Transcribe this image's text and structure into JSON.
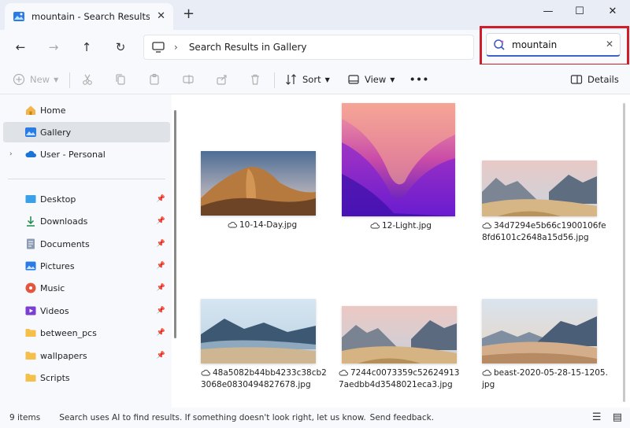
{
  "tab": {
    "title": "mountain - Search Results in Gallery",
    "close": "✕"
  },
  "new_tab": "+",
  "window_controls": {
    "minimize": "—",
    "maximize": "☐",
    "close": "✕"
  },
  "nav": {
    "back": "←",
    "forward": "→",
    "up": "↑",
    "refresh": "↻"
  },
  "address": {
    "separator": "›",
    "crumb": "Search Results in Gallery"
  },
  "search": {
    "value": "mountain",
    "clear": "✕"
  },
  "commands": {
    "new": "New",
    "sort": "Sort",
    "view": "View",
    "more": "•••",
    "details": "Details"
  },
  "sidebar": {
    "items": [
      {
        "label": "Home",
        "icon": "home-icon",
        "pinned": false
      },
      {
        "label": "Gallery",
        "icon": "gallery-icon",
        "pinned": false,
        "selected": true
      },
      {
        "label": "User - Personal",
        "icon": "onedrive-cloud-icon",
        "pinned": false,
        "expander": "›"
      },
      {
        "label": "Desktop",
        "icon": "desktop-icon",
        "pinned": true
      },
      {
        "label": "Downloads",
        "icon": "downloads-icon",
        "pinned": true
      },
      {
        "label": "Documents",
        "icon": "documents-icon",
        "pinned": true
      },
      {
        "label": "Pictures",
        "icon": "pictures-icon",
        "pinned": true
      },
      {
        "label": "Music",
        "icon": "music-icon",
        "pinned": true
      },
      {
        "label": "Videos",
        "icon": "videos-icon",
        "pinned": true
      },
      {
        "label": "between_pcs",
        "icon": "folder-icon",
        "pinned": true
      },
      {
        "label": "wallpapers",
        "icon": "folder-icon",
        "pinned": true
      },
      {
        "label": "Scripts",
        "icon": "folder-icon",
        "pinned": false
      }
    ],
    "pin_glyph": "📌"
  },
  "files": [
    {
      "name": "10-14-Day.jpg"
    },
    {
      "name": "12-Light.jpg"
    },
    {
      "name": "34d7294e5b66c1900106fe8fd6101c2648a15d56.jpg"
    },
    {
      "name": "48a5082b44bb4233c38cb23068e0830494827678.jpg"
    },
    {
      "name": "7244c0073359c526249137aedbb4d3548021eca3.jpg"
    },
    {
      "name": "beast-2020-05-28-15-1205.jpg"
    }
  ],
  "status": {
    "count": "9 items",
    "message": "Search uses AI to find results. If something doesn't look right, let us know.",
    "feedback": "Send feedback."
  },
  "colors": {
    "accent": "#3e63c8",
    "highlight": "#d01d2a",
    "selected_bg": "#dfe3e8"
  }
}
